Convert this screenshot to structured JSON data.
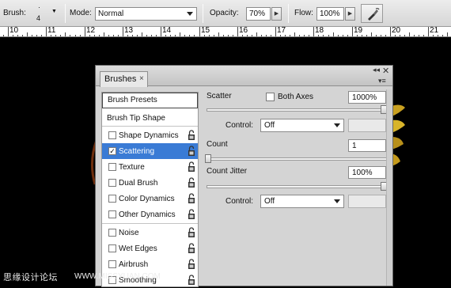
{
  "options_bar": {
    "brush_label": "Brush:",
    "brush_size": "4",
    "mode_label": "Mode:",
    "mode_value": "Normal",
    "opacity_label": "Opacity:",
    "opacity_value": "70%",
    "flow_label": "Flow:",
    "flow_value": "100%"
  },
  "ruler": {
    "labels": [
      "10",
      "11",
      "12",
      "13",
      "14",
      "15",
      "16",
      "17",
      "18",
      "19",
      "20",
      "21"
    ]
  },
  "panel": {
    "tab_label": "Brushes",
    "tab_close": "×",
    "close_glyph": "✕",
    "collapse_glyph": "◂◂",
    "menu_glyph": "▾≡",
    "left_list": {
      "presets": "Brush Presets",
      "tip_shape": "Brush Tip Shape",
      "items": [
        {
          "label": "Shape Dynamics",
          "checked": false,
          "selected": false
        },
        {
          "label": "Scattering",
          "checked": true,
          "selected": true
        },
        {
          "label": "Texture",
          "checked": false,
          "selected": false
        },
        {
          "label": "Dual Brush",
          "checked": false,
          "selected": false
        },
        {
          "label": "Color Dynamics",
          "checked": false,
          "selected": false
        },
        {
          "label": "Other Dynamics",
          "checked": false,
          "selected": false
        },
        {
          "label": "Noise",
          "checked": false,
          "selected": false
        },
        {
          "label": "Wet Edges",
          "checked": false,
          "selected": false
        },
        {
          "label": "Airbrush",
          "checked": false,
          "selected": false
        },
        {
          "label": "Smoothing",
          "checked": false,
          "selected": false
        }
      ]
    },
    "scatter": {
      "label": "Scatter",
      "both_axes_label": "Both Axes",
      "value": "1000%",
      "slider_level": 1.0,
      "control_label": "Control:",
      "control_value": "Off"
    },
    "count": {
      "label": "Count",
      "value": "1",
      "slider_level": 0.0
    },
    "count_jitter": {
      "label": "Count Jitter",
      "value": "100%",
      "slider_level": 1.0,
      "control_label": "Control:",
      "control_value": "Off"
    }
  },
  "watermark": {
    "text": "思缘设计论坛",
    "url": "WWW.MISSYUAN.COM"
  }
}
